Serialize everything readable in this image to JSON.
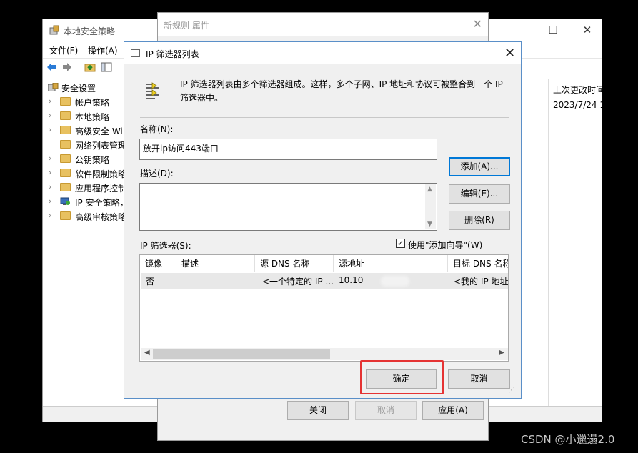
{
  "mmc": {
    "title": "本地安全策略",
    "menu": [
      "文件(F)",
      "操作(A)"
    ],
    "tree": [
      {
        "label": "安全设置",
        "icon": "security-settings-icon"
      },
      {
        "label": "帐户策略",
        "icon": "folder-lock-icon"
      },
      {
        "label": "本地策略",
        "icon": "folder-lock-icon"
      },
      {
        "label": "高级安全 Wi",
        "icon": "folder-icon"
      },
      {
        "label": "网络列表管理",
        "icon": "folder-icon"
      },
      {
        "label": "公钥策略",
        "icon": "folder-icon"
      },
      {
        "label": "软件限制策略",
        "icon": "folder-icon"
      },
      {
        "label": "应用程序控制",
        "icon": "folder-icon"
      },
      {
        "label": "IP 安全策略，",
        "icon": "ip-security-icon"
      },
      {
        "label": "高级审核策略",
        "icon": "folder-icon"
      }
    ],
    "right_header": "上次更改时间",
    "right_value": "2023/7/24 1"
  },
  "props": {
    "title": "新规则 属性",
    "close_label": "关闭",
    "cancel_label": "取消",
    "apply_label": "应用(A)"
  },
  "dialog": {
    "title": "IP 筛选器列表",
    "description": "IP 筛选器列表由多个筛选器组成。这样，多个子网、IP 地址和协议可被整合到一个 IP 筛选器中。",
    "name_label": "名称(N):",
    "name_value": "放开ip访问443端口",
    "desc_label": "描述(D):",
    "desc_value": "",
    "add_label": "添加(A)...",
    "edit_label": "编辑(E)...",
    "remove_label": "删除(R)",
    "filters_label": "IP 筛选器(S):",
    "wizard_label": "使用\"添加向导\"(W)",
    "wizard_checked": "✓",
    "columns": [
      "镜像",
      "描述",
      "源 DNS 名称",
      "源地址",
      "目标 DNS 名称"
    ],
    "rows": [
      [
        "否",
        "",
        "<一个特定的 IP ...",
        "10.10",
        "<我的 IP 地址"
      ]
    ],
    "ok_label": "确定",
    "cancel_label": "取消"
  },
  "watermark": "CSDN @小邋遢2.0",
  "colors": {
    "accent": "#0078d7",
    "highlight": "#e53333"
  }
}
